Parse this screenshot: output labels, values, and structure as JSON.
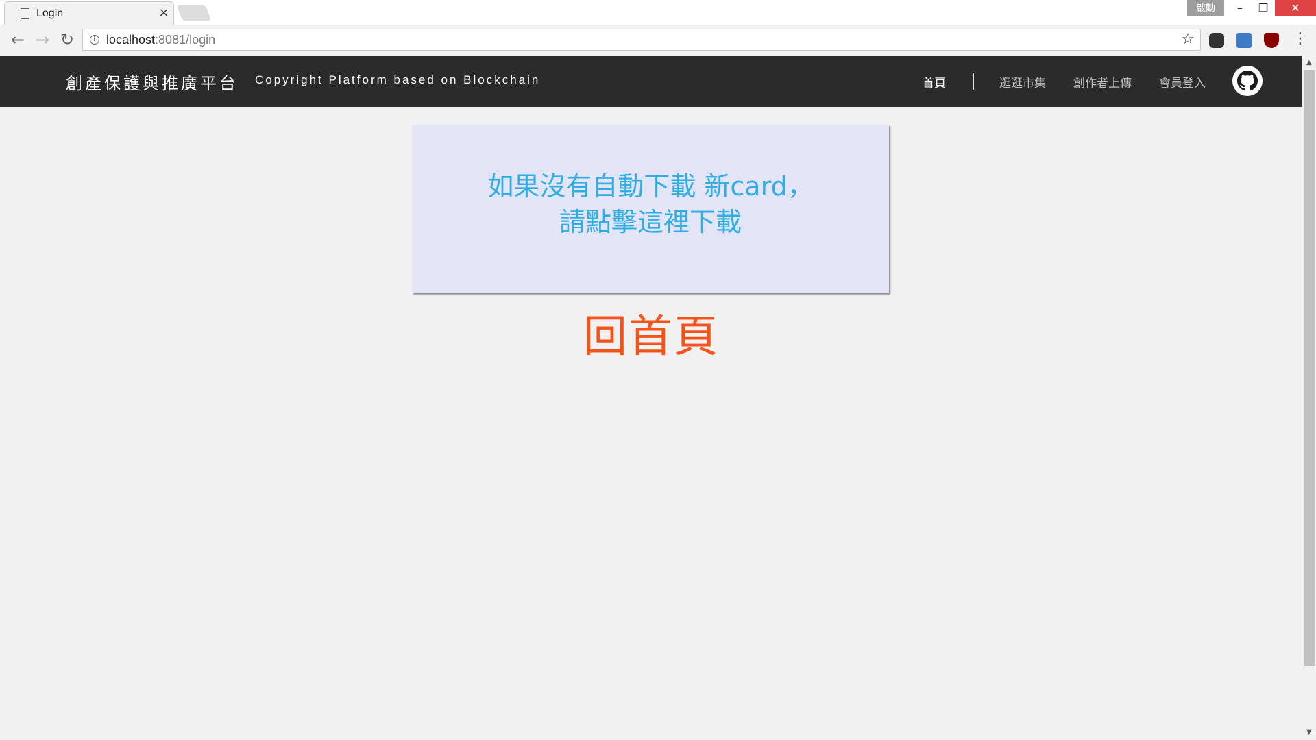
{
  "browser": {
    "tab_title": "Login",
    "tab_close": "×",
    "window_badge": "啟動",
    "minimize": "–",
    "maximize": "❐",
    "close": "✕",
    "url_host": "localhost",
    "url_rest": ":8081/login",
    "back": "←",
    "forward": "→",
    "reload": "↻",
    "star": "☆",
    "menu": "⋮",
    "info": "i"
  },
  "site": {
    "brand_zh": "創產保護與推廣平台",
    "brand_en": "Copyright Platform based on Blockchain",
    "nav": [
      {
        "label": "首頁",
        "active": true
      },
      {
        "label": "逛逛市集",
        "active": false
      },
      {
        "label": "創作者上傳",
        "active": false
      },
      {
        "label": "會員登入",
        "active": false
      }
    ]
  },
  "card": {
    "line1": "如果沒有自動下載 新card，",
    "line2": "請點擊這裡下載"
  },
  "home_link": "回首頁",
  "colors": {
    "navbar": "#2b2b2b",
    "card_bg": "#e4e4f7",
    "card_text": "#2eaee2",
    "home_link": "#f2541a",
    "page_bg": "#f1f1f1"
  }
}
